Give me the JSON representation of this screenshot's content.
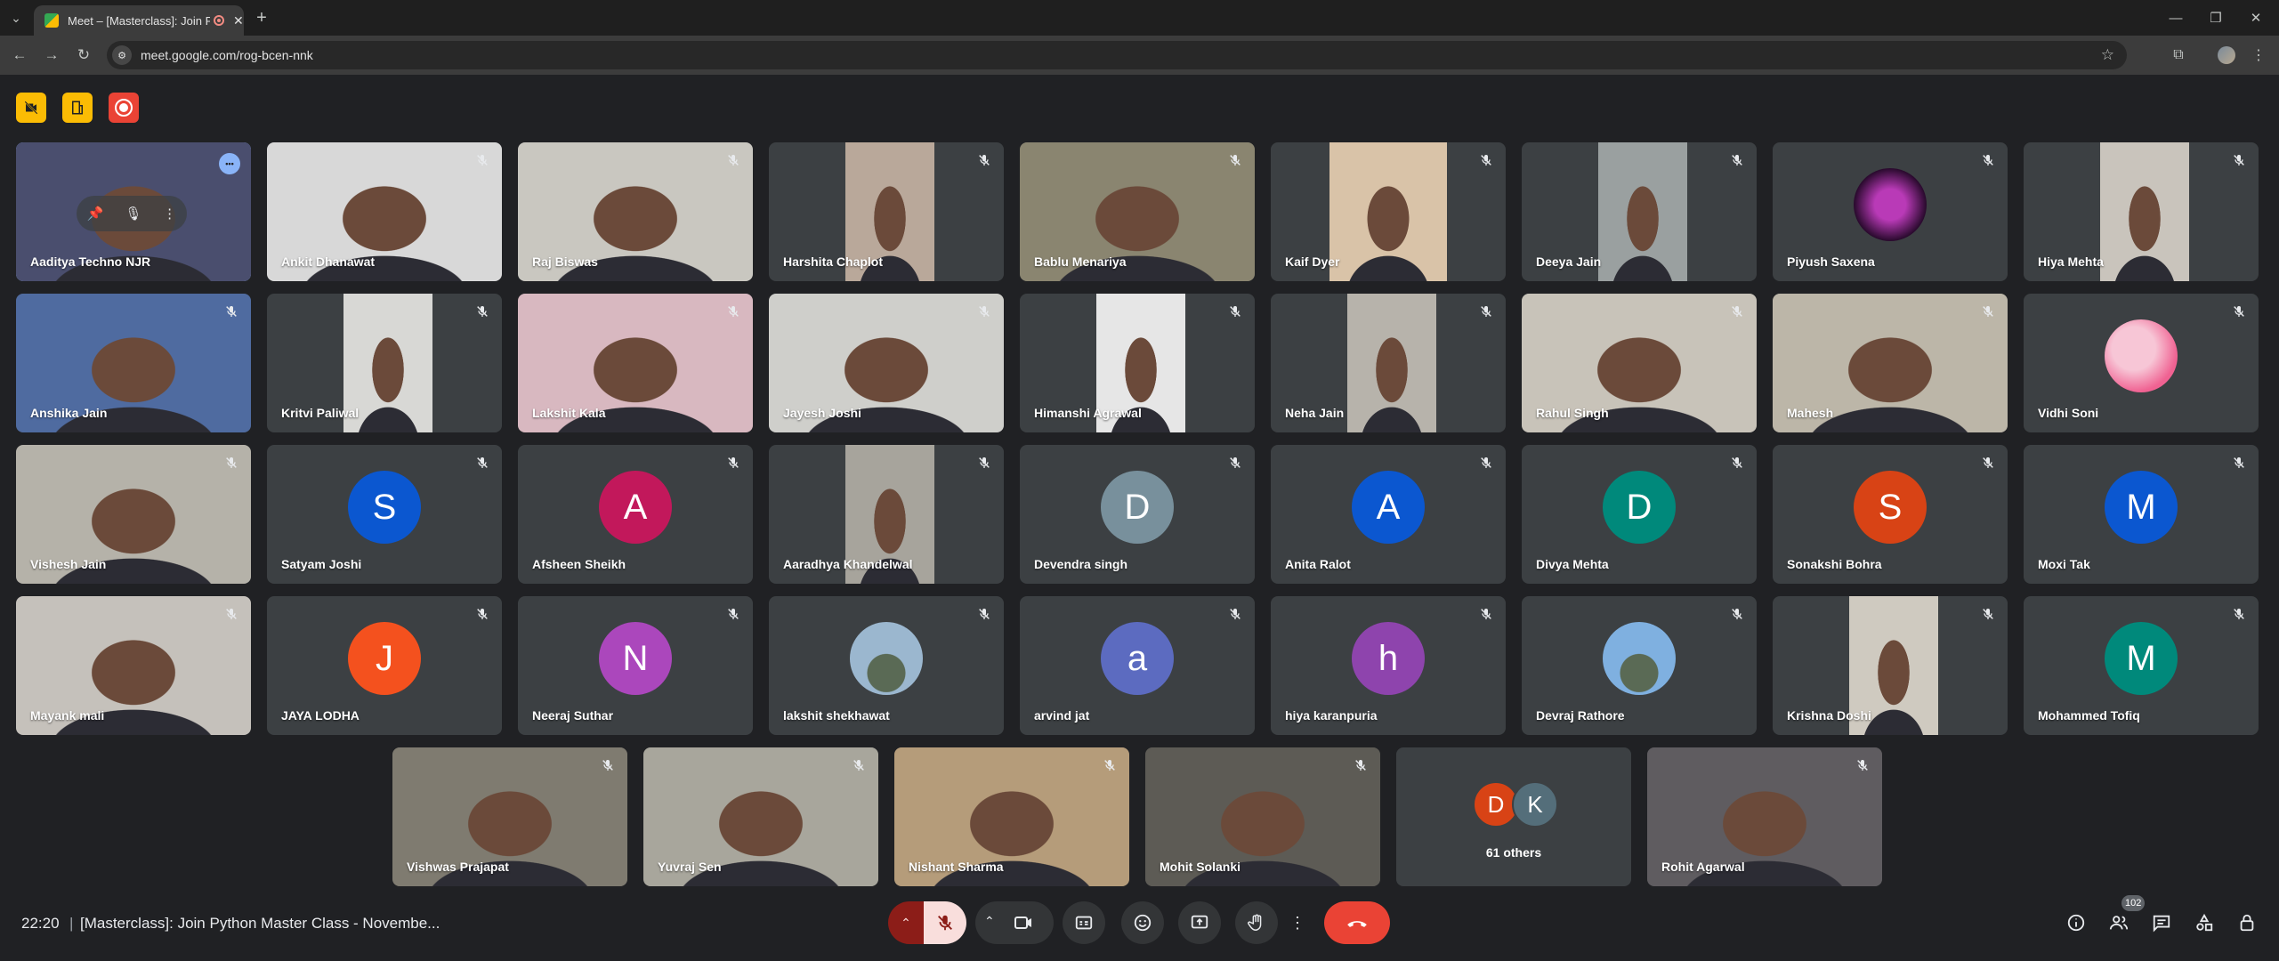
{
  "browser": {
    "tab_title": "Meet – [Masterclass]: Join P",
    "url": "meet.google.com/rog-bcen-nnk"
  },
  "meeting": {
    "time": "22:20",
    "separator": "|",
    "title": "[Masterclass]: Join Python Master Class - Novembe...",
    "participant_count": "102",
    "others_label": "61 others"
  },
  "tiles_row1": [
    {
      "name": "Aaditya Techno NJR",
      "video": "#4a4e6e"
    },
    {
      "name": "Ankit Dhanawat",
      "video": "#d8d8d8"
    },
    {
      "name": "Raj Biswas",
      "video": "#c9c7c0"
    },
    {
      "name": "Harshita Chaplot",
      "video": "#b9a89a"
    },
    {
      "name": "Bablu Menariya",
      "video": "#8a8570"
    },
    {
      "name": "Kaif Dyer",
      "video": "#d9c3a8"
    },
    {
      "name": "Deeya Jain",
      "video": "#9aa0a0"
    },
    {
      "name": "Piyush Saxena",
      "video": "avatar"
    },
    {
      "name": "Hiya Mehta",
      "video": "#c9c4bc"
    }
  ],
  "tiles_row2": [
    {
      "name": "Anshika Jain",
      "video": "#4f6ba0"
    },
    {
      "name": "Kritvi Paliwal",
      "video": "#d8d8d5"
    },
    {
      "name": "Lakshit Kala",
      "video": "#d8b8c0"
    },
    {
      "name": "Jayesh Joshi",
      "video": "#cfcfcb"
    },
    {
      "name": "Himanshi Agrawal",
      "video": "#e6e6e6"
    },
    {
      "name": "Neha Jain",
      "video": "#b7b3ab"
    },
    {
      "name": "Rahul Singh",
      "video": "#c8c3b9"
    },
    {
      "name": "Mahesh",
      "video": "#bcb6a8"
    },
    {
      "name": "Vidhi Soni",
      "video": "avatar"
    }
  ],
  "tiles_row3": [
    {
      "name": "Vishesh Jain",
      "video": "#b5b2a9"
    },
    {
      "name": "Satyam Joshi",
      "initial": "S",
      "color": "#0b57d0"
    },
    {
      "name": "Afsheen Sheikh",
      "initial": "A",
      "color": "#c2185b"
    },
    {
      "name": "Aaradhya Khandelwal",
      "video": "#a7a49c"
    },
    {
      "name": "Devendra singh",
      "initial": "D",
      "color": "#78909c"
    },
    {
      "name": "Anita Ralot",
      "initial": "A",
      "color": "#0b57d0"
    },
    {
      "name": "Divya Mehta",
      "initial": "D",
      "color": "#00897b"
    },
    {
      "name": "Sonakshi Bohra",
      "initial": "S",
      "color": "#d84315"
    },
    {
      "name": "Moxi Tak",
      "initial": "M",
      "color": "#0b57d0"
    }
  ],
  "tiles_row4": [
    {
      "name": "Mayank mali",
      "video": "#c5c1bb"
    },
    {
      "name": "JAYA LODHA",
      "initial": "J",
      "color": "#f4511e"
    },
    {
      "name": "Neeraj Suthar",
      "initial": "N",
      "color": "#ab47bc"
    },
    {
      "name": "lakshit shekhawat",
      "photo": "#9bb7cf"
    },
    {
      "name": "arvind jat",
      "initial": "a",
      "color": "#5c6bc0"
    },
    {
      "name": "hiya karanpuria",
      "initial": "h",
      "color": "#8e44ad"
    },
    {
      "name": "Devraj Rathore",
      "photo": "#7fb0e0"
    },
    {
      "name": "Krishna Doshi",
      "video": "#cfcac0"
    },
    {
      "name": "Mohammed Tofiq",
      "initial": "M",
      "color": "#00897b"
    }
  ],
  "tiles_row5": [
    {
      "name": "Vishwas Prajapat",
      "video": "#7f7b70"
    },
    {
      "name": "Yuvraj Sen",
      "video": "#a8a69c"
    },
    {
      "name": "Nishant Sharma",
      "video": "#b59c7a"
    },
    {
      "name": "Mohit Solanki",
      "video": "#5d5b55"
    },
    {
      "name": "others",
      "video": "others"
    },
    {
      "name": "Rohit Agarwal",
      "video": "#5f5c60"
    }
  ],
  "others_avatars": [
    {
      "initial": "D",
      "color": "#d84315"
    },
    {
      "initial": "K",
      "color": "#546e7a"
    }
  ],
  "colors": {
    "accent": "#8ab4f8",
    "hangup": "#ea4335",
    "warning": "#fbbc04",
    "mic_muted_bg": "#f9dedc"
  }
}
